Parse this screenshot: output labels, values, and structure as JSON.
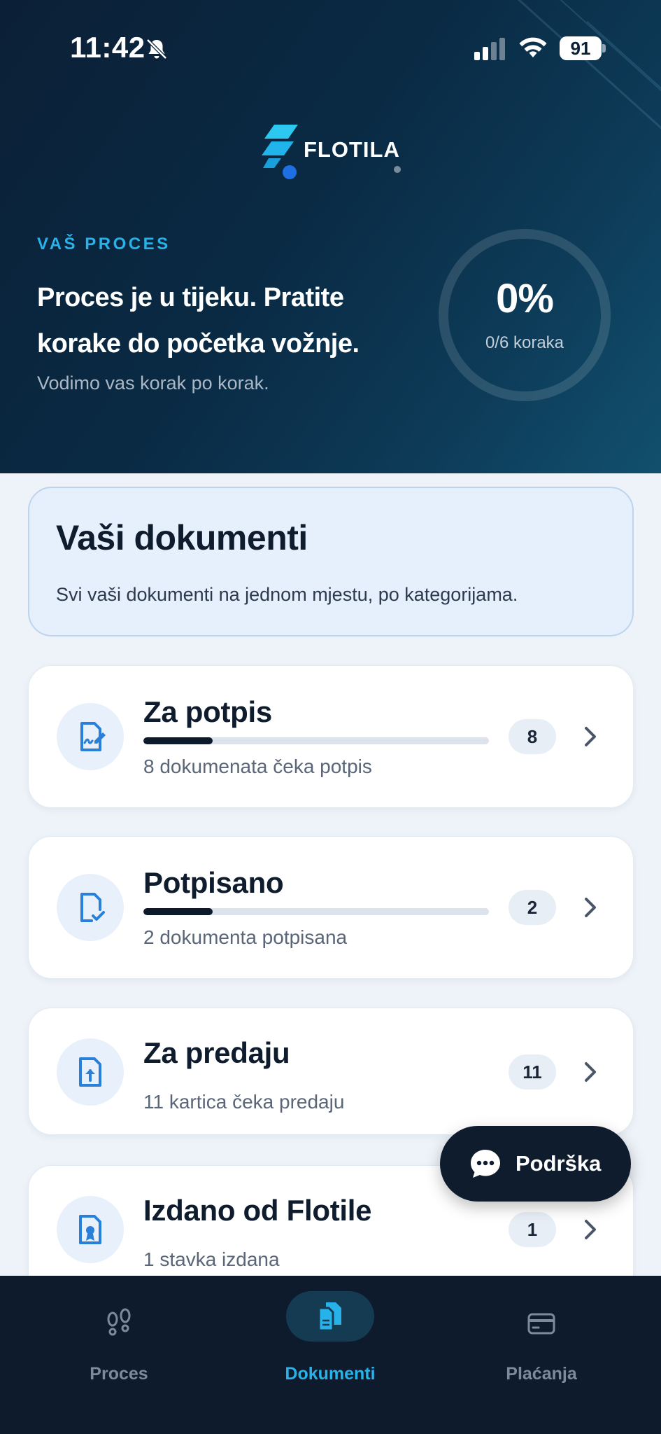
{
  "status_bar": {
    "time": "11:42",
    "battery": "91"
  },
  "brand": {
    "name": "FLOTILA"
  },
  "process": {
    "eyebrow": "VAŠ PROCES",
    "title": "Proces je u tijeku. Pratite korake do početka vožnje.",
    "subtitle": "Vodimo vas korak po korak.",
    "percent": "0%",
    "steps": "0/6 koraka",
    "progress_fraction": 0
  },
  "documents": {
    "title": "Vaši dokumenti",
    "subtitle": "Svi vaši dokumenti na jednom mjestu, po kategorijama.",
    "categories": [
      {
        "title": "Za potpis",
        "description": "8 dokumenata čeka potpis",
        "count": "8",
        "icon": "signature-document-icon",
        "progress": 0.2
      },
      {
        "title": "Potpisano",
        "description": "2 dokumenta potpisana",
        "count": "2",
        "icon": "signed-document-icon",
        "progress": 0.2
      },
      {
        "title": "Za predaju",
        "description": "11 kartica čeka predaju",
        "count": "11",
        "icon": "upload-document-icon"
      },
      {
        "title": "Izdano od Flotile",
        "description": "1 stavka izdana",
        "count": "1",
        "icon": "certificate-document-icon"
      }
    ]
  },
  "support": {
    "label": "Podrška"
  },
  "nav": {
    "tabs": [
      {
        "label": "Proces",
        "icon": "footsteps-icon",
        "active": false
      },
      {
        "label": "Dokumenti",
        "icon": "documents-icon",
        "active": true
      },
      {
        "label": "Plaćanja",
        "icon": "credit-card-icon",
        "active": false
      }
    ]
  },
  "colors": {
    "accent": "#27b3ea",
    "navy": "#0f1c2e",
    "hero_bg": "#0b2036",
    "card_icon_bg": "#e8f0fb",
    "icon_blue": "#2a7fd8"
  }
}
